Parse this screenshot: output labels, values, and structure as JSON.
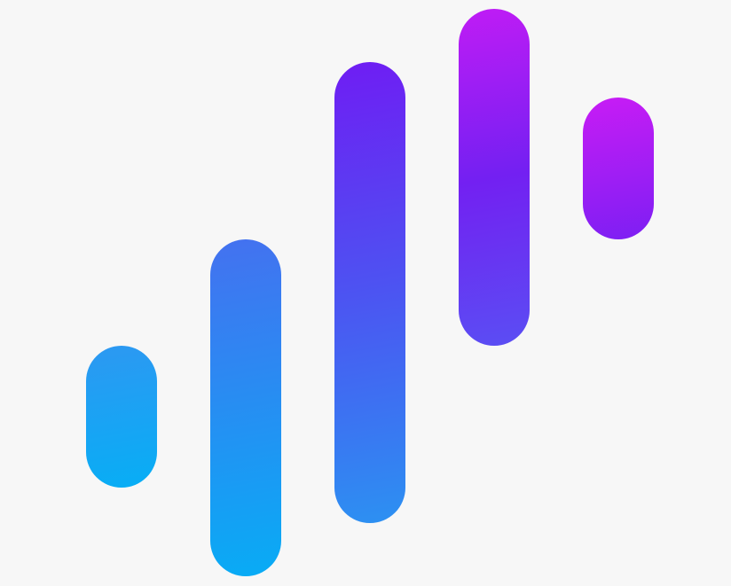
{
  "background_color": "#f7f7f7",
  "logo": {
    "icon": "equalizer-bars-logo-icon",
    "bars": [
      {
        "name": "bar-1",
        "color_top": "#2d98f2",
        "color_bottom": "#07aef5"
      },
      {
        "name": "bar-2",
        "color_top": "#4471f0",
        "color_bottom": "#08acf5"
      },
      {
        "name": "bar-3",
        "color_top": "#6f1df3",
        "color_mid": "#4c54f2",
        "color_bottom": "#2c91f2"
      },
      {
        "name": "bar-4",
        "color_top": "#c01cf5",
        "color_mid": "#7320f2",
        "color_bottom": "#5a4ef3"
      },
      {
        "name": "bar-5",
        "color_top": "#c81cf5",
        "color_bottom": "#7d1ff3"
      }
    ]
  }
}
